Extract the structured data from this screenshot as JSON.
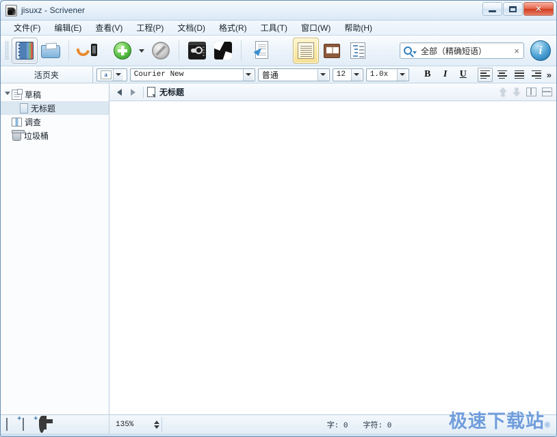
{
  "window": {
    "title": "jisuxz - Scrivener",
    "app_icon": "scrivener-icon",
    "minimize_label": "–",
    "maximize_label": "□",
    "close_label": "✕"
  },
  "menubar": {
    "items": [
      {
        "label": "文件(F)",
        "name": "menu-file"
      },
      {
        "label": "编辑(E)",
        "name": "menu-edit"
      },
      {
        "label": "查看(V)",
        "name": "menu-view"
      },
      {
        "label": "工程(P)",
        "name": "menu-project"
      },
      {
        "label": "文档(D)",
        "name": "menu-document"
      },
      {
        "label": "格式(R)",
        "name": "menu-format"
      },
      {
        "label": "工具(T)",
        "name": "menu-tools"
      },
      {
        "label": "窗口(W)",
        "name": "menu-window"
      },
      {
        "label": "帮助(H)",
        "name": "menu-help"
      }
    ]
  },
  "toolbar": {
    "buttons": [
      {
        "name": "toggle-binder-button",
        "icon": "binder-icon",
        "active": true
      },
      {
        "name": "toggle-collections-button",
        "icon": "folder-icon",
        "active": false
      },
      {
        "name": "sync-button",
        "icon": "sync-mobile-icon",
        "active": false
      },
      {
        "name": "add-button",
        "icon": "green-plus-icon",
        "active": false
      },
      {
        "name": "add-dropdown",
        "icon": "chevron-down-icon",
        "active": false
      },
      {
        "name": "no-style-button",
        "icon": "no-entry-icon",
        "active": false
      },
      {
        "name": "composition-key-button",
        "icon": "dark-keyboard-icon",
        "active": false
      },
      {
        "name": "full-screen-button",
        "icon": "compose-mode-icon",
        "active": false
      },
      {
        "name": "import-button",
        "icon": "import-document-icon",
        "active": false
      },
      {
        "name": "document-view-button",
        "icon": "page-view-icon",
        "active": true
      },
      {
        "name": "corkboard-view-button",
        "icon": "corkboard-icon",
        "active": false
      },
      {
        "name": "outliner-view-button",
        "icon": "outliner-icon",
        "active": false
      }
    ],
    "search": {
      "value": "全部（精确短语）",
      "clear_label": "×",
      "icon": "search-icon"
    },
    "inspector": {
      "name": "inspector-button",
      "label": "i"
    }
  },
  "binder": {
    "header": "活页夹",
    "items": [
      {
        "label": "草稿",
        "icon": "draft-folder-icon",
        "level": 0,
        "expanded": true,
        "selected": false
      },
      {
        "label": "无标题",
        "icon": "text-document-icon",
        "level": 1,
        "expanded": false,
        "selected": true
      },
      {
        "label": "调查",
        "icon": "research-folder-icon",
        "level": 0,
        "expanded": false,
        "selected": false
      },
      {
        "label": "垃圾桶",
        "icon": "trash-icon",
        "level": 0,
        "expanded": false,
        "selected": false
      }
    ]
  },
  "formatbar": {
    "style_swatch": "a",
    "font": "Courier New",
    "weight": "普通",
    "size": "12",
    "line_spacing": "1.0x",
    "bold": "B",
    "italic": "I",
    "underline": "U",
    "align": [
      "align-left",
      "align-center",
      "align-right",
      "align-justify"
    ],
    "align_active": 0,
    "overflow": "»"
  },
  "editor": {
    "back_icon": "arrow-left-icon",
    "forward_icon": "arrow-right-icon",
    "doc_icon": "document-icon",
    "title": "无标题",
    "right_icons": [
      "arrow-up-icon",
      "arrow-down-icon",
      "split-vertical-icon",
      "split-horizontal-icon"
    ],
    "content": ""
  },
  "statusbar": {
    "icons": [
      {
        "name": "new-text-button",
        "icon": "new-text-icon"
      },
      {
        "name": "new-folder-button",
        "icon": "new-folder-icon"
      },
      {
        "name": "settings-button",
        "icon": "gear-icon"
      }
    ],
    "zoom": "135%",
    "word_count_label": "字: 0",
    "char_count_label": "字符: 0"
  },
  "watermark": {
    "text": "极速下载站",
    "mark": "®"
  },
  "colors": {
    "accent": "#5b8fd6",
    "frame": "#cfe0ef",
    "selection": "#dbe7f1",
    "active_tool": "#fff6d7",
    "close_button": "#cf3d22"
  }
}
